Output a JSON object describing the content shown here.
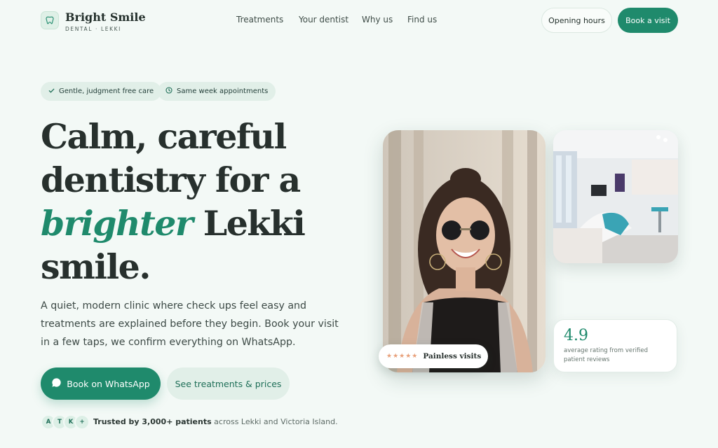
{
  "brand": {
    "name": "Bright Smile",
    "subtitle": "DENTAL · LEKKI",
    "logo_icon": "tooth-icon"
  },
  "nav": {
    "items": [
      {
        "label": "Treatments"
      },
      {
        "label": "Your dentist"
      },
      {
        "label": "Why us"
      },
      {
        "label": "Find us"
      }
    ],
    "opening_hours_label": "Opening hours",
    "book_label": "Book a visit"
  },
  "badges": [
    {
      "label": "Gentle, judgment free care",
      "icon": "check-icon"
    },
    {
      "label": "Same week appointments",
      "icon": "clock-icon"
    }
  ],
  "hero": {
    "title_line1": "Calm, careful",
    "title_line2": "dentistry for a",
    "title_em": "brighter",
    "title_line3_rest": " Lekki",
    "title_line4": "smile.",
    "description": "A quiet, modern clinic where check ups feel easy and treatments are explained before they begin. Book your visit in a few taps, we confirm everything on WhatsApp.",
    "cta_primary": "Book on WhatsApp",
    "cta_secondary": "See treatments & prices"
  },
  "trust": {
    "avatars": [
      "A",
      "T",
      "K",
      "+"
    ],
    "highlight": "Trusted by 3,000+ patients",
    "rest": " across Lekki and Victoria Island."
  },
  "rating": {
    "value": "4.9",
    "caption": "average rating from verified patient reviews"
  },
  "painless": {
    "stars": "★★★★★",
    "label": "Painless visits"
  },
  "colors": {
    "accent": "#1f8a6c",
    "background": "#f3f9f6",
    "badge_bg": "#e1efe8",
    "star": "#e8a07a"
  }
}
